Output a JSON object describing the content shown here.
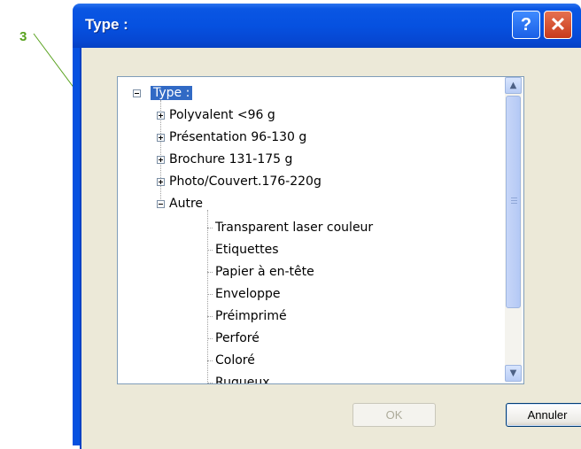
{
  "callout": {
    "number": "3"
  },
  "window": {
    "title": "Type :"
  },
  "titlebar": {
    "help_label": "?",
    "close_label": "✕"
  },
  "tree": {
    "root_label": "Type :",
    "collapsed_items": [
      "Polyvalent <96 g",
      "Présentation 96-130 g",
      "Brochure 131-175 g",
      "Photo/Couvert.176-220g"
    ],
    "expanded_item": "Autre",
    "children": [
      "Transparent laser couleur",
      "Etiquettes",
      "Papier à en-tête",
      "Enveloppe",
      "Préimprimé",
      "Perforé",
      "Coloré",
      "Rugueux"
    ]
  },
  "scrollbar": {
    "up_icon": "▲",
    "down_icon": "▼"
  },
  "buttons": {
    "ok_label": "OK",
    "cancel_label": "Annuler"
  },
  "colors": {
    "callout": "#57a11c",
    "titlebar": "#0651e0",
    "selection": "#316ac5"
  }
}
